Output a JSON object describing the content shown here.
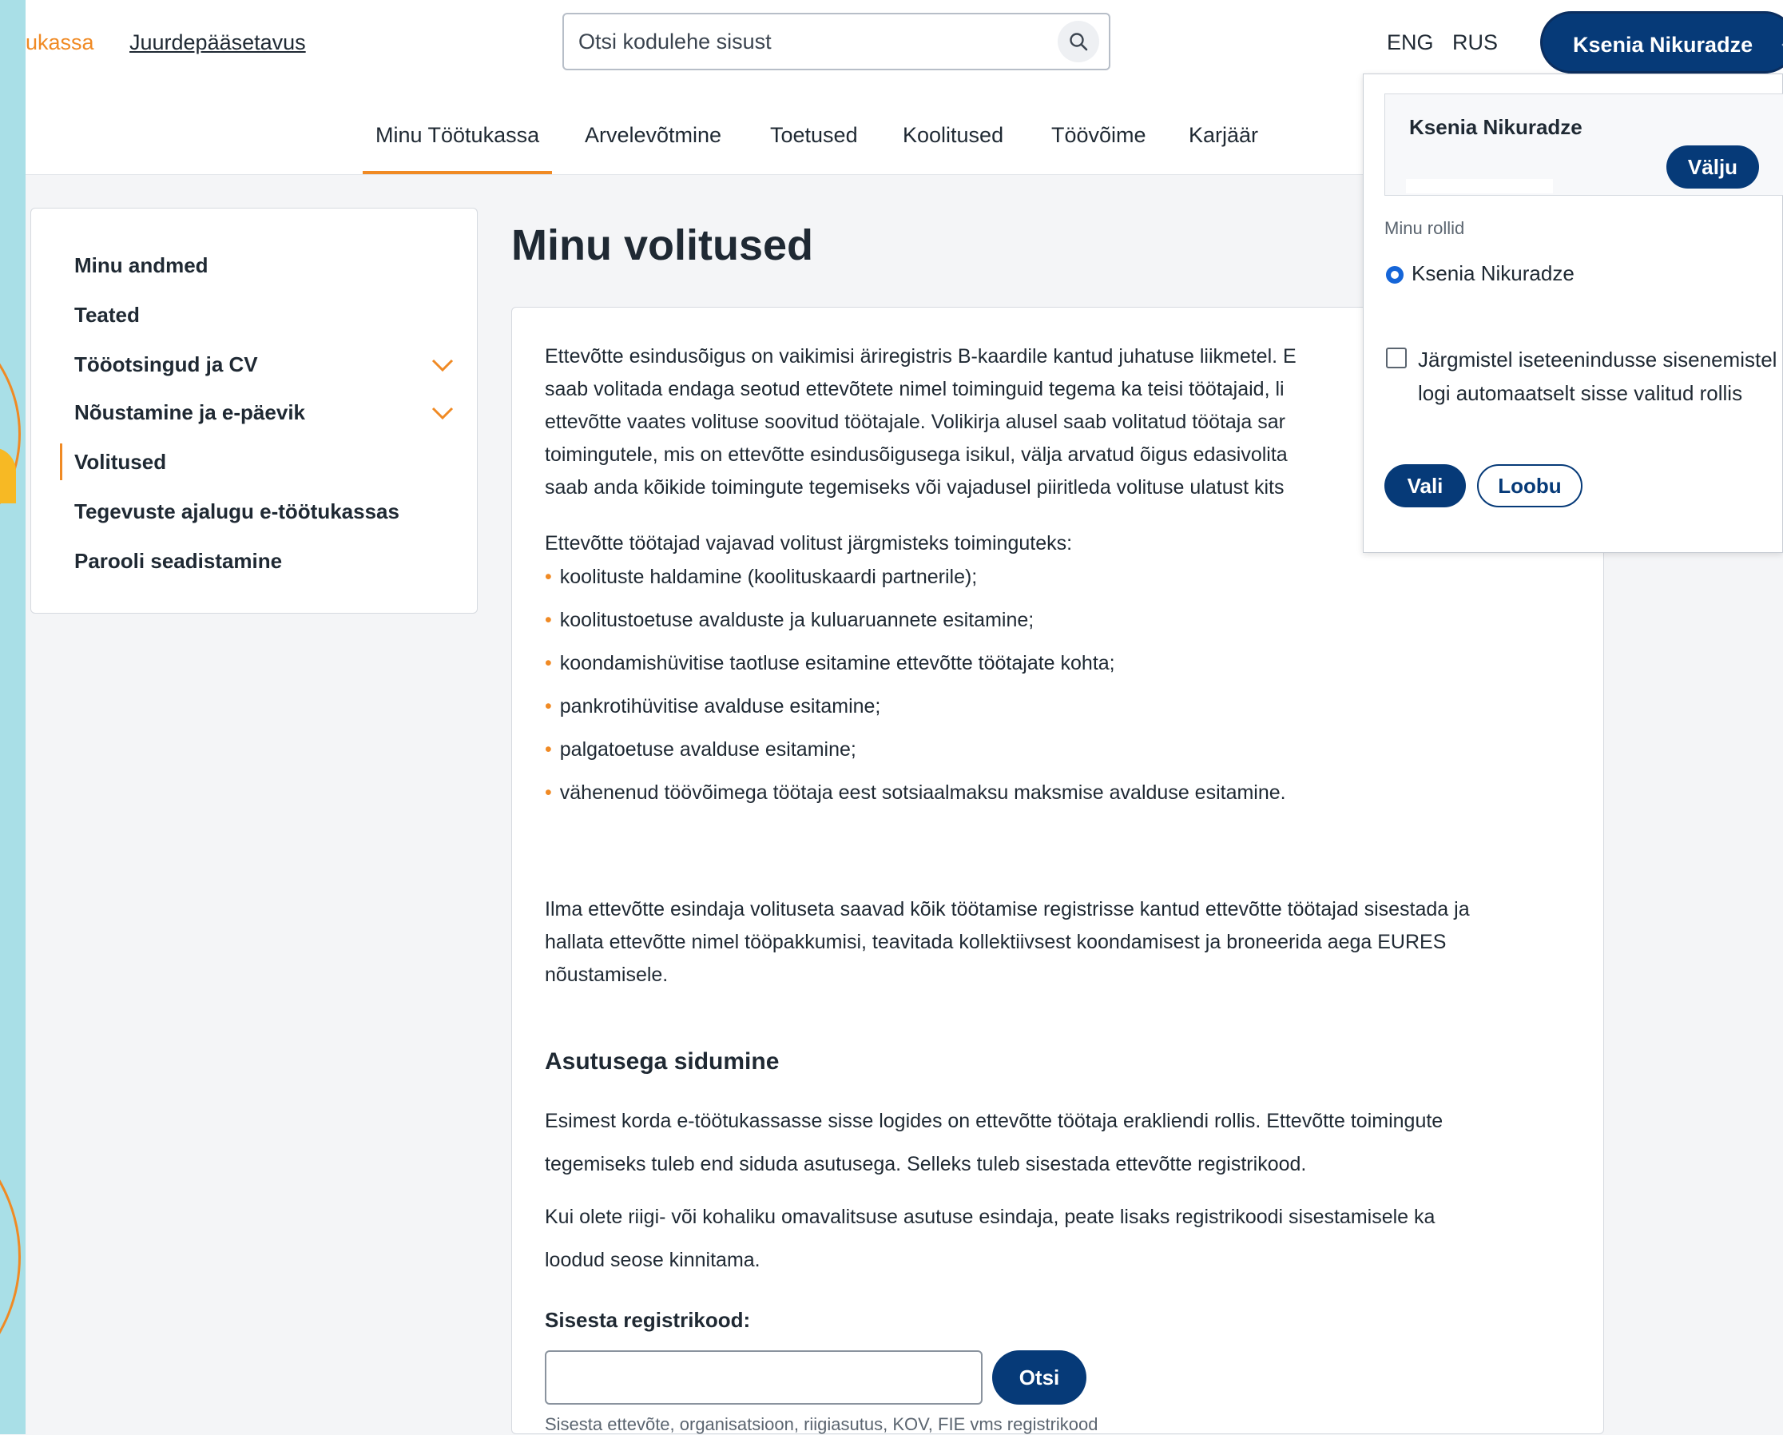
{
  "header": {
    "brand": "ukassa",
    "access_link": "Juurdepääsetavus",
    "search_placeholder": "Otsi kodulehe sisust",
    "lang_eng": "ENG",
    "lang_rus": "RUS",
    "user_name": "Ksenia Nikuradze",
    "brand_color": "#f08a24",
    "primary_color": "#063a78"
  },
  "nav": {
    "tabs": [
      {
        "label": "Minu Töötukassa",
        "active": true
      },
      {
        "label": "Arvelevõtmine"
      },
      {
        "label": "Toetused"
      },
      {
        "label": "Koolitused"
      },
      {
        "label": "Töövõime"
      },
      {
        "label": "Karjäär"
      }
    ]
  },
  "sidebar": {
    "items": [
      {
        "label": "Minu andmed"
      },
      {
        "label": "Teated"
      },
      {
        "label": "Tööotsingud ja CV",
        "expandable": true
      },
      {
        "label": "Nõustamine ja e-päevik",
        "expandable": true
      },
      {
        "label": "Volitused",
        "active": true
      },
      {
        "label": "Tegevuste ajalugu e-töötukassas"
      },
      {
        "label": "Parooli seadistamine"
      }
    ]
  },
  "main": {
    "title": "Minu volitused",
    "intro_lines": [
      "Ettevõtte esindusõigus on vaikimisi äriregistris B-kaardile kantud juhatuse liikmetel. E",
      "saab volitada endaga seotud ettevõtete nimel toiminguid tegema ka teisi töötajaid, li",
      "ettevõtte vaates volituse soovitud töötajale. Volikirja alusel saab volitatud töötaja sar",
      "toimingutele, mis on ettevõtte esindusõigusega isikul, välja arvatud õigus edasivolita",
      "saab anda kõikide toimingute tegemiseks või vajadusel piiritleda volituse ulatust kits"
    ],
    "needs_text": "Ettevõtte töötajad vajavad volitust järgmisteks toiminguteks:",
    "bullets": [
      "koolituste haldamine (koolituskaardi partnerile);",
      "koolitustoetuse avalduste ja kuluaruannete esitamine;",
      "koondamishüvitise taotluse esitamine ettevõtte töötajate kohta;",
      "pankrotihüvitise avalduse esitamine;",
      "palgatoetuse avalduse esitamine;",
      "vähenenud töövõimega töötaja eest sotsiaalmaksu maksmise avalduse esitamine."
    ],
    "no_auth_lines": [
      "Ilma ettevõtte esindaja volituseta saavad kõik töötamise registrisse kantud ettevõtte töötajad sisestada ja",
      "hallata ettevõtte nimel tööpakkumisi, teavitada kollektiivsest koondamisest ja broneerida aega EURES",
      "nõustamisele."
    ],
    "section_title": "Asutusega sidumine",
    "section_p1_lines": [
      "Esimest korda e-töötukassasse sisse logides on ettevõtte töötaja erakliendi rollis. Ettevõtte toimingute",
      "tegemiseks tuleb end siduda asutusega. Selleks tuleb sisestada ettevõtte registrikood."
    ],
    "section_p2_lines": [
      "Kui olete riigi- või kohaliku omavalitsuse asutuse esindaja, peate lisaks registrikoodi sisestamisele ka",
      "loodud seose kinnitama."
    ],
    "reg_label": "Sisesta registrikood:",
    "reg_value": "",
    "search_button": "Otsi",
    "reg_hint": "Sisesta ettevõte, organisatsioon, riigiasutus, KOV, FIE vms registrikood"
  },
  "dropdown": {
    "user_name": "Ksenia Nikuradze",
    "logout_button": "Välju",
    "roles_label": "Minu rollid",
    "role_option": "Ksenia Nikuradze",
    "remember_label": "Järgmistel iseteenindusse sisenemistel logi automaatselt sisse valitud rollis",
    "select_button": "Vali",
    "cancel_button": "Loobu"
  }
}
